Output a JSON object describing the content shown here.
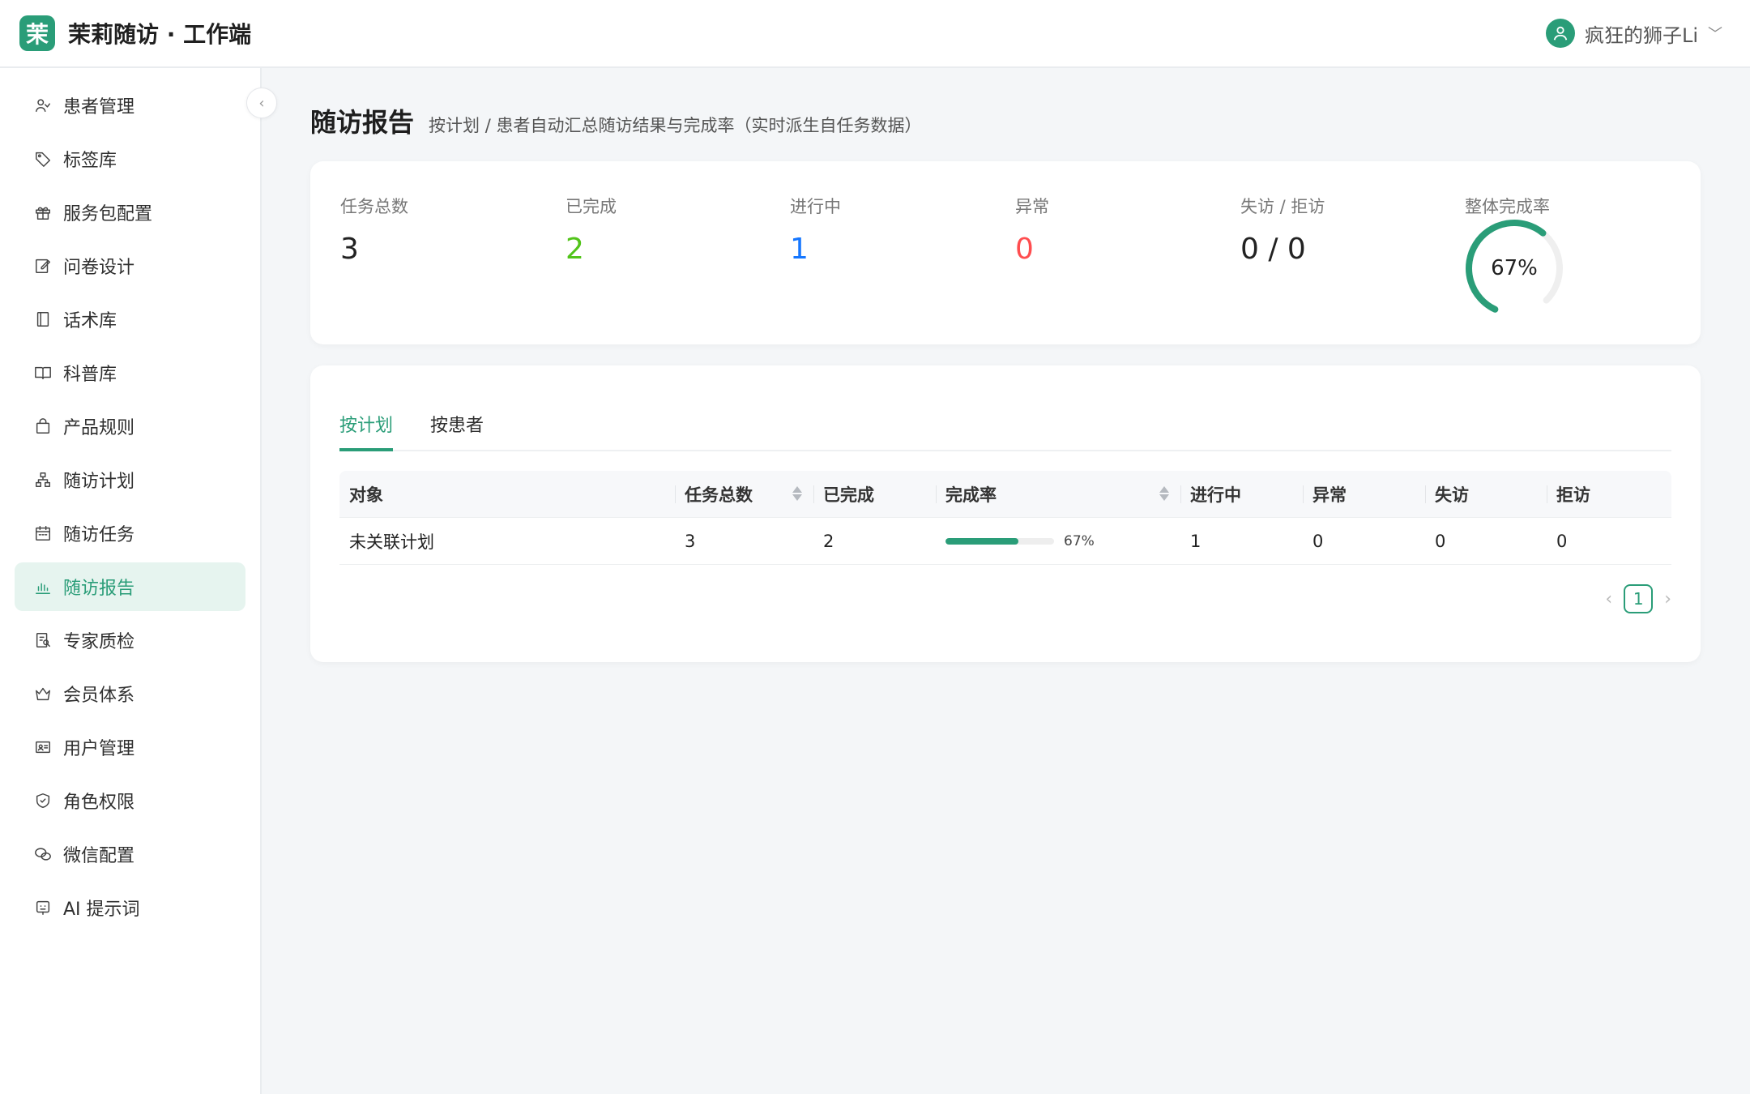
{
  "app": {
    "logo_char": "茉",
    "title": "茉莉随访 · 工作端",
    "accent": "#2a9d78"
  },
  "user": {
    "name": "疯狂的狮子Li",
    "icon": "user-icon"
  },
  "sidebar": {
    "items": [
      {
        "label": "患者管理",
        "icon": "patients-icon"
      },
      {
        "label": "标签库",
        "icon": "tag-icon"
      },
      {
        "label": "服务包配置",
        "icon": "gift-icon"
      },
      {
        "label": "问卷设计",
        "icon": "edit-icon"
      },
      {
        "label": "话术库",
        "icon": "book-icon"
      },
      {
        "label": "科普库",
        "icon": "open-book-icon"
      },
      {
        "label": "产品规则",
        "icon": "bag-icon"
      },
      {
        "label": "随访计划",
        "icon": "org-chart-icon"
      },
      {
        "label": "随访任务",
        "icon": "calendar-icon"
      },
      {
        "label": "随访报告",
        "icon": "bar-chart-icon",
        "active": true
      },
      {
        "label": "专家质检",
        "icon": "audit-icon"
      },
      {
        "label": "会员体系",
        "icon": "crown-icon"
      },
      {
        "label": "用户管理",
        "icon": "id-card-icon"
      },
      {
        "label": "角色权限",
        "icon": "shield-icon"
      },
      {
        "label": "微信配置",
        "icon": "wechat-icon"
      },
      {
        "label": "AI 提示词",
        "icon": "robot-icon"
      }
    ]
  },
  "page": {
    "title": "随访报告",
    "subtitle": "按计划 / 患者自动汇总随访结果与完成率（实时派生自任务数据）"
  },
  "stats": {
    "total": {
      "label": "任务总数",
      "value": "3"
    },
    "done": {
      "label": "已完成",
      "value": "2",
      "color": "#52c41a"
    },
    "ongoing": {
      "label": "进行中",
      "value": "1",
      "color": "#1677ff"
    },
    "abnormal": {
      "label": "异常",
      "value": "0",
      "color": "#ff4d4f"
    },
    "lost": {
      "label": "失访 / 拒访",
      "value": "0 / 0"
    },
    "rate": {
      "label": "整体完成率",
      "value": "67%",
      "fraction": 0.67
    }
  },
  "tabs": [
    {
      "label": "按计划",
      "active": true
    },
    {
      "label": "按患者",
      "active": false
    }
  ],
  "table": {
    "headers": [
      "对象",
      "任务总数",
      "已完成",
      "完成率",
      "进行中",
      "异常",
      "失访",
      "拒访"
    ],
    "rows": [
      {
        "object": "未关联计划",
        "total": "3",
        "done": "2",
        "rate_text": "67%",
        "rate": 0.67,
        "ongoing": "1",
        "abnormal": "0",
        "lost": "0",
        "refused": "0"
      }
    ]
  },
  "pagination": {
    "current": "1"
  }
}
